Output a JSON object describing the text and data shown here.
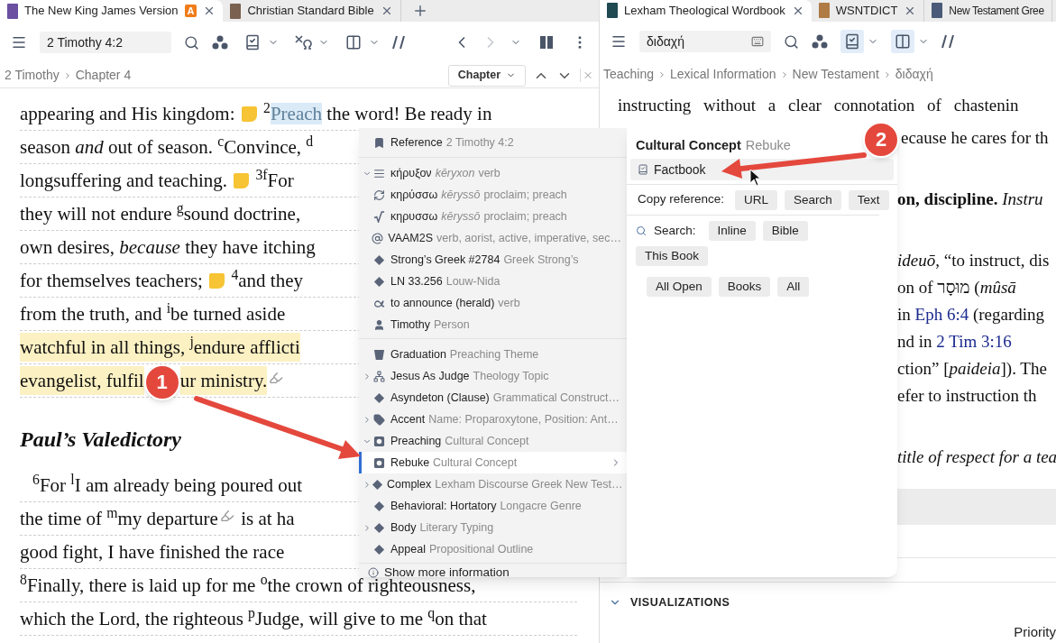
{
  "left_pane": {
    "tabs": [
      {
        "title": "The New King James Version",
        "badge": "A",
        "selected": true,
        "color": "#6b4fa0"
      },
      {
        "title": "Christian Standard Bible",
        "selected": false,
        "color": "#7a6150"
      }
    ],
    "search": {
      "value": "2 Timothy 4:2"
    },
    "toggles": [
      {
        "kind": "filters",
        "selected": false
      },
      {
        "kind": "interlinear",
        "selected": false
      },
      {
        "kind": "layout",
        "selected": false
      }
    ],
    "nav": {
      "back_disabled": false,
      "forward_disabled": true
    },
    "breadcrumb": [
      "2 Timothy",
      "Chapter 4"
    ],
    "section_dropdown": "Chapter",
    "lines": [
      {
        "highlighted": false,
        "segments": [
          {
            "kind": "text",
            "text": "appearing and His kingdom: ",
            "selected": false
          },
          {
            "kind": "note"
          },
          {
            "kind": "text",
            "text": " $^{2}$",
            "selected": false
          },
          {
            "kind": "text",
            "text": "Preach",
            "selected": true
          },
          {
            "kind": "text",
            "text": " the word! Be ready in",
            "selected": false
          }
        ]
      },
      {
        "highlighted": false,
        "segments": [
          {
            "kind": "text",
            "text": "season *and* out of season. $^{c}$Convince, $^{d}$"
          }
        ]
      },
      {
        "highlighted": false,
        "segments": [
          {
            "kind": "text",
            "text": "longsuffering and teaching. "
          },
          {
            "kind": "note"
          },
          {
            "kind": "text",
            "text": " $^{3}$$^{f}$For"
          }
        ]
      },
      {
        "highlighted": false,
        "segments": [
          {
            "kind": "text",
            "text": "they will not endure $^{g}$sound doctrine,"
          }
        ]
      },
      {
        "highlighted": false,
        "segments": [
          {
            "kind": "text",
            "text": "own desires, *because* they have itching"
          }
        ]
      },
      {
        "highlighted": false,
        "segments": [
          {
            "kind": "text",
            "text": "for themselves teachers; "
          },
          {
            "kind": "note"
          },
          {
            "kind": "text",
            "text": " $^{4}$and they"
          }
        ]
      },
      {
        "highlighted": false,
        "segments": [
          {
            "kind": "text",
            "text": "from the truth, and $^{i}$be turned aside"
          }
        ]
      },
      {
        "highlighted": true,
        "segments": [
          {
            "kind": "text",
            "text": "watchful in all things, $^{j}$endure afflicti"
          }
        ]
      },
      {
        "highlighted": true,
        "segments": [
          {
            "kind": "text",
            "text": "evangelist, fulfil"
          },
          {
            "kind": "callout",
            "label": "1"
          },
          {
            "kind": "text",
            "text": "ur ministry."
          },
          {
            "kind": "pencil"
          }
        ]
      }
    ],
    "heading": "Paul’s Valedictory",
    "lines_after": [
      {
        "highlighted": false,
        "segments": [
          {
            "kind": "text",
            "text": "$^{6}$For $^{l}$I am already being poured out"
          }
        ]
      },
      {
        "highlighted": false,
        "segments": [
          {
            "kind": "text",
            "text": "the time of $^{m}$my departure"
          },
          {
            "kind": "pencil"
          },
          {
            "kind": "text",
            "text": " is at ha"
          }
        ]
      },
      {
        "highlighted": false,
        "segments": [
          {
            "kind": "text",
            "text": "good fight, I have finished the race"
          }
        ]
      },
      {
        "highlighted": false,
        "segments": [
          {
            "kind": "text",
            "text": "$^{8}$Finally, there is laid up for me $^{o}$the crown of righteousness,"
          }
        ]
      },
      {
        "highlighted": false,
        "segments": [
          {
            "kind": "text",
            "text": "which the Lord, the righteous $^{p}$Judge, will give to me $^{q}$on that"
          }
        ]
      }
    ]
  },
  "right_pane": {
    "tabs": [
      {
        "title": "Lexham Theological Wordbook",
        "selected": true,
        "color": "#1f4a52"
      },
      {
        "title": "WSNTDICT",
        "selected": false,
        "color": "#b07a45"
      },
      {
        "title": "New Testament Gree",
        "selected": false,
        "color": "#4a5a78"
      }
    ],
    "search": {
      "value": "διδαχή"
    },
    "toggles": [
      {
        "kind": "filters",
        "selected": true
      },
      {
        "kind": "layout",
        "selected": true
      }
    ],
    "breadcrumb": [
      "Teaching",
      "Lexical Information",
      "New Testament",
      "διδαχή"
    ],
    "first_line": "instructing without a clear connotation of chastenin",
    "paragraphs": [
      [
        [
          {
            "kind": "callout",
            "label": "2"
          },
          {
            "kind": "text",
            "text": "ecause he cares for th"
          }
        ]
      ],
      [
        [
          {
            "kind": "text",
            "text": "**on, discipline.** *Instru*"
          }
        ]
      ],
      [
        [
          {
            "kind": "text",
            "text": "*ideuō*, “to instruct, dis"
          }
        ],
        [
          {
            "kind": "text",
            "text": "on of מוּסָר (*mûsā*"
          }
        ],
        [
          {
            "kind": "text",
            "text": "in "
          },
          {
            "kind": "link",
            "text": "Eph 6:4"
          },
          {
            "kind": "text",
            "text": " (regarding"
          }
        ],
        [
          {
            "kind": "text",
            "text": "nd in "
          },
          {
            "kind": "link",
            "text": "2 Tim 3:16"
          }
        ],
        [
          {
            "kind": "text",
            "text": "ction” [*paideia*]). The"
          }
        ],
        [
          {
            "kind": "text",
            "text": "efer to instruction th"
          }
        ]
      ],
      [
        [
          {
            "kind": "italic",
            "text": "title of respect for a tea"
          }
        ]
      ]
    ],
    "section": {
      "title": "VISUALIZATIONS",
      "expanded": true
    },
    "footer_label": "Priority"
  },
  "context_menu": {
    "groups": [
      [
        {
          "kind": "bookmark",
          "label": "Reference",
          "detail": "2 Timothy 4:2",
          "selected": false
        }
      ],
      [
        {
          "kind": "lemma",
          "label": "κήρυξον",
          "translit": "kēryxon",
          "detail": "verb",
          "expanded": true,
          "selected": false
        },
        {
          "kind": "cycle",
          "label": "κηρύσσω",
          "translit": "kēryssō",
          "detail": "proclaim; preach",
          "selected": false
        },
        {
          "kind": "root",
          "label": "κηρυσσω",
          "translit": "kēryssō",
          "detail": "proclaim; preach",
          "selected": false
        },
        {
          "kind": "at",
          "label": "VAAM2S",
          "detail": "verb, aorist, active, imperative, sec…",
          "selected": false
        },
        {
          "kind": "diamond",
          "label": "Strong’s Greek #2784",
          "detail": "Greek Strong’s",
          "selected": false
        },
        {
          "kind": "diamond",
          "label": "LN 33.256",
          "detail": "Louw-Nida",
          "selected": false
        },
        {
          "kind": "sense",
          "label": "to announce (herald)",
          "detail": "verb",
          "selected": false
        },
        {
          "kind": "person",
          "label": "Timothy",
          "detail": "Person",
          "selected": false
        }
      ],
      [
        {
          "kind": "bucket",
          "label": "Graduation",
          "detail": "Preaching Theme",
          "selected": false
        },
        {
          "kind": "tree",
          "label": "Jesus As Judge",
          "detail": "Theology Topic",
          "expanded": false,
          "selected": false
        },
        {
          "kind": "diamond",
          "label": "Asyndeton (Clause)",
          "detail": "Grammatical Construct…",
          "selected": false
        },
        {
          "kind": "tag",
          "label": "Accent",
          "detail": "Name: Proparoxytone, Position: Ant…",
          "expanded": false,
          "selected": false
        },
        {
          "kind": "concept",
          "label": "Preaching",
          "detail": "Cultural Concept",
          "expanded": true,
          "selected": false
        },
        {
          "kind": "concept",
          "label": "Rebuke",
          "detail": "Cultural Concept",
          "selected": true
        },
        {
          "kind": "diamond",
          "label": "Complex",
          "detail": "Lexham Discourse Greek New Test…",
          "expanded": false,
          "selected": false
        },
        {
          "kind": "diamond",
          "label": "Behavioral: Hortatory",
          "detail": "Longacre Genre",
          "selected": false
        },
        {
          "kind": "diamond",
          "label": "Body",
          "detail": "Literary Typing",
          "expanded": false,
          "selected": false
        },
        {
          "kind": "diamond",
          "label": "Appeal",
          "detail": "Propositional Outline",
          "selected": false
        }
      ]
    ],
    "footer": "Show more information"
  },
  "fact_panel": {
    "title": "Cultural Concept",
    "subtitle": "Rebuke",
    "link": "Factbook",
    "copy_label": "Copy reference:",
    "copy_buttons": [
      "URL",
      "Search",
      "Text"
    ],
    "search_label": "Search:",
    "search_buttons": [
      "Inline",
      "Bible",
      "This Book",
      "All Open",
      "Books",
      "All"
    ]
  }
}
